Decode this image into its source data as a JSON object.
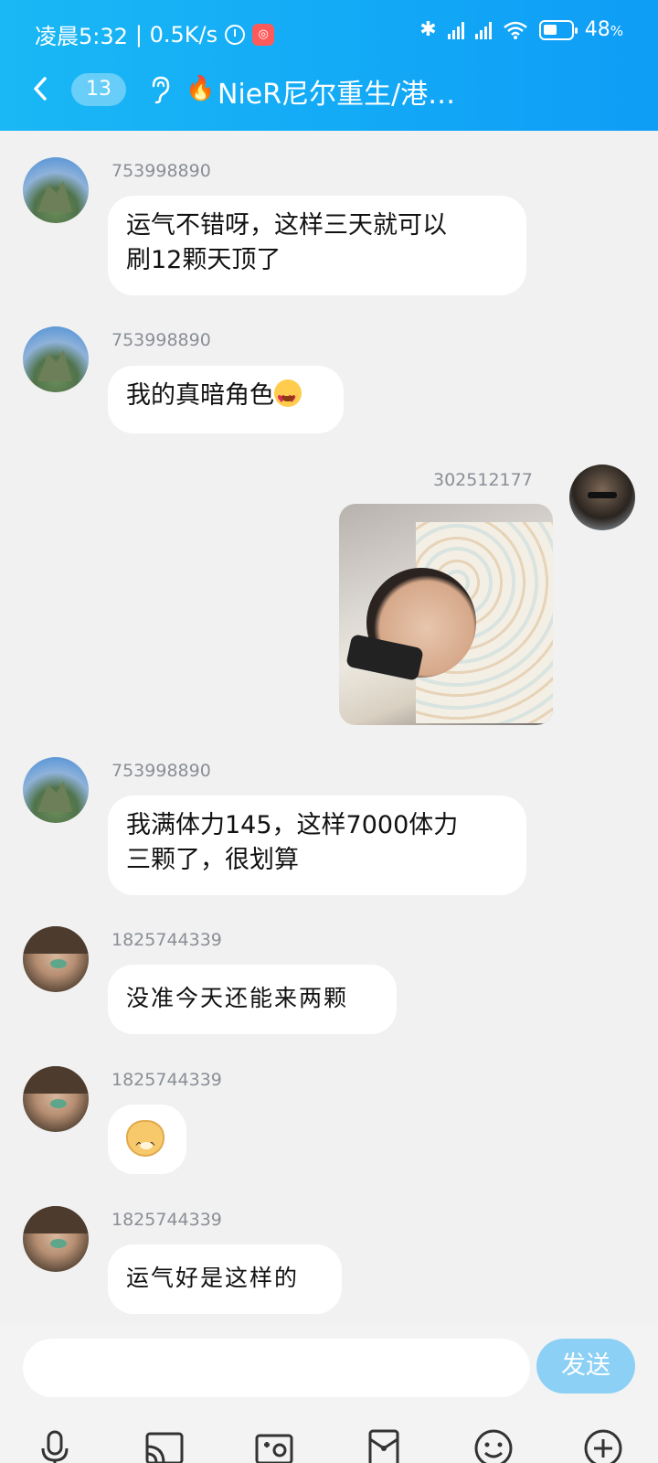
{
  "status_bar": {
    "time": "凌晨5:32",
    "net_speed": "| 0.5K/s",
    "battery": "48",
    "battery_unit": "%"
  },
  "header": {
    "unread_count": "13",
    "title": "NieR尼尔重生/港…",
    "title_prefix_icon": "fire-icon"
  },
  "messages": [
    {
      "sender": "753998890",
      "text_line1": "运气不错呀，这样三天就可以",
      "text_line2": "刷12颗天顶了"
    },
    {
      "sender": "753998890",
      "text": "我的真暗角色",
      "emoji": "heart-eyes-emoji"
    },
    {
      "sender": "302512177",
      "type": "image",
      "image_desc": "photo"
    },
    {
      "sender": "753998890",
      "text_line1": "我满体力145，这样7000体力",
      "text_line2": "三颗了，很划算"
    },
    {
      "sender": "1825744339",
      "text": "没准今天还能来两颗"
    },
    {
      "sender": "1825744339",
      "type": "sticker",
      "emoji": "doge-icon"
    },
    {
      "sender": "1825744339",
      "text": "运气好是这样的"
    }
  ],
  "input": {
    "placeholder": "",
    "send_label": "发送"
  },
  "toolbar": [
    "microphone-icon",
    "screen-cast-icon",
    "camera-icon",
    "red-packet-icon",
    "emoji-icon",
    "plus-icon"
  ]
}
